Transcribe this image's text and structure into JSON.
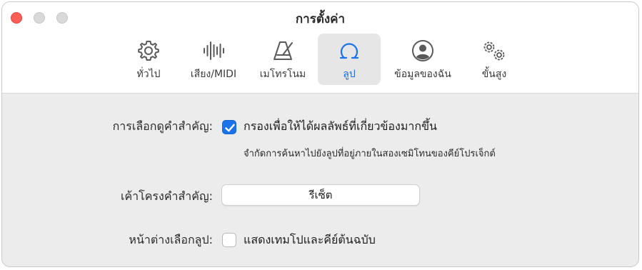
{
  "window": {
    "title": "การตั้งค่า"
  },
  "tabs": [
    {
      "label": "ทั่วไป",
      "icon": "gear-icon",
      "selected": false
    },
    {
      "label": "เสียง/MIDI",
      "icon": "waveform-icon",
      "selected": false
    },
    {
      "label": "เมโทรโนม",
      "icon": "metronome-icon",
      "selected": false
    },
    {
      "label": "ลูป",
      "icon": "loop-icon",
      "selected": true
    },
    {
      "label": "ข้อมูลของฉัน",
      "icon": "person-circle-icon",
      "selected": false
    },
    {
      "label": "ขั้นสูง",
      "icon": "gears-icon",
      "selected": false
    }
  ],
  "settings": {
    "key_filter": {
      "label": "การเลือกดูคำสำคัญ:",
      "checkbox_label": "กรองเพื่อให้ได้ผลลัพธ์ที่เกี่ยวข้องมากขึ้น",
      "checked": true,
      "help": "จำกัดการค้นหาไปยังลูปที่อยู่ภายในสองเซมิโทนของคีย์โปรเจ็กต์"
    },
    "keyword_layout": {
      "label": "เค้าโครงคำสำคัญ:",
      "button_label": "รีเซ็ต"
    },
    "loop_browser": {
      "label": "หน้าต่างเลือกลูป:",
      "checkbox_label": "แสดงเทมโปและคีย์ต้นฉบับ",
      "checked": false
    }
  },
  "colors": {
    "accent": "#1a73e8",
    "close": "#ff5f57",
    "selected_tab_bg": "#e6e6e6"
  }
}
